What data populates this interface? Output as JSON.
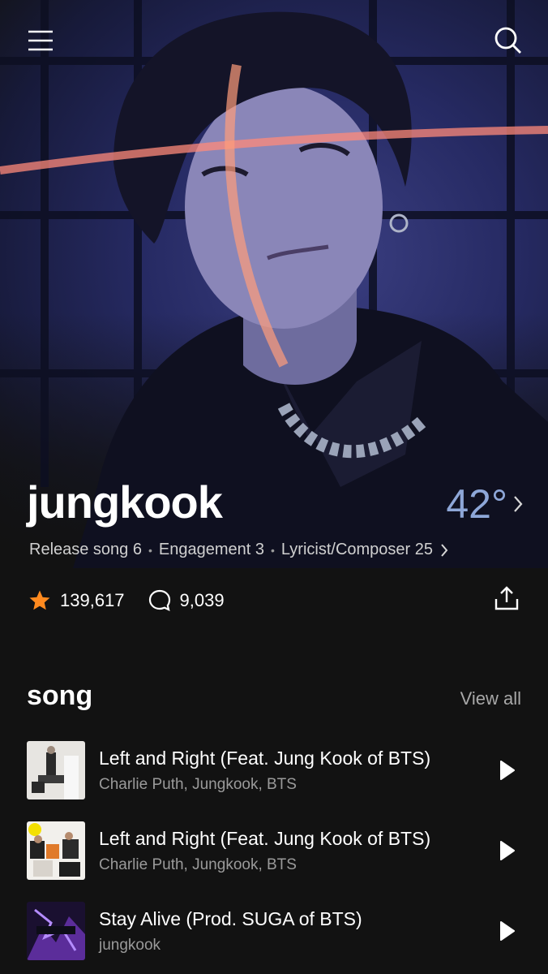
{
  "header": {
    "menu_icon": "menu-icon",
    "search_icon": "search-icon"
  },
  "artist": {
    "name": "jungkook",
    "temperature": "42°",
    "stats": {
      "release": "Release song 6",
      "engagement": "Engagement 3",
      "lyricist": "Lyricist/Composer 25"
    },
    "likes": "139,617",
    "comments": "9,039"
  },
  "songs_section": {
    "title": "song",
    "view_all": "View all",
    "items": [
      {
        "title": "Left and Right (Feat. Jung Kook of BTS)",
        "artist": "Charlie Puth, Jungkook, BTS"
      },
      {
        "title": "Left and Right (Feat. Jung Kook of BTS)",
        "artist": "Charlie Puth, Jungkook, BTS"
      },
      {
        "title": "Stay Alive (Prod. SUGA of BTS)",
        "artist": "jungkook"
      }
    ]
  },
  "colors": {
    "background": "#121212",
    "accent_temperature": "#8ea7d8",
    "star": "#ff8a1f"
  }
}
